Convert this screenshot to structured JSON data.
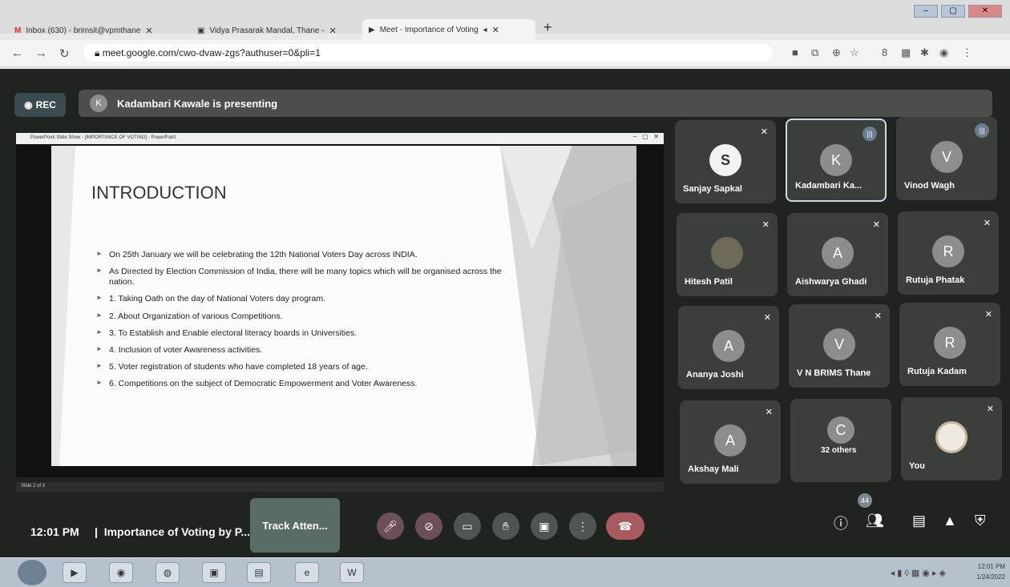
{
  "browser": {
    "tabs": [
      {
        "label": "Inbox (630) - brimsit@vpmthane",
        "icon": "gmail-icon"
      },
      {
        "label": "Vidya Prasarak Mandal, Thane -",
        "icon": "page-icon"
      },
      {
        "label": "Meet - Importance of Voting",
        "icon": "meet-icon"
      }
    ],
    "url": "meet.google.com/cwo-dvaw-zgs?authuser=0&pli=1"
  },
  "meet": {
    "rec_label": "REC",
    "presenting_initial": "K",
    "presenting_text": "Kadambari Kawale is presenting",
    "clock": "12:01 PM",
    "meeting_title": "Importance of Voting by P...",
    "track_label": "Track Atten...",
    "people_badge": "44"
  },
  "slide": {
    "window_title": "PowerPoint Slide Show - [IMPORTANCE OF VOTING] - PowerPoint",
    "heading": "INTRODUCTION",
    "bullets": [
      "On 25th January we will be celebrating the 12th National Voters Day across INDIA.",
      "As Directed by Election Commission of India, there will be many topics which will be organised across the nation.",
      "1. Taking Oath on the day of National Voters day program.",
      "2. About Organization of various Competitions.",
      "3. To Establish and Enable electoral literacy boards in Universities.",
      "4. Inclusion of voter Awareness activities.",
      "5. Voter registration of students who have completed 18 years of age.",
      "6. Competitions on the subject of Democratic Empowerment and Voter Awareness."
    ],
    "footer": "Slide 2 of 3"
  },
  "participants": [
    {
      "name": "Sanjay Sapkal",
      "initial": "S",
      "mic": "muted"
    },
    {
      "name": "Kadambari Ka...",
      "initial": "K",
      "mic": "talking"
    },
    {
      "name": "Vinod Wagh",
      "initial": "V",
      "mic": "talking"
    },
    {
      "name": "Hitesh Patil",
      "initial": "",
      "mic": "muted"
    },
    {
      "name": "Aishwarya Ghadi",
      "initial": "A",
      "mic": "muted"
    },
    {
      "name": "Rutuja Phatak",
      "initial": "R",
      "mic": "muted"
    },
    {
      "name": "Ananya Joshi",
      "initial": "A",
      "mic": "muted"
    },
    {
      "name": "V N BRIMS Thane",
      "initial": "V",
      "mic": "muted"
    },
    {
      "name": "Rutuja Kadam",
      "initial": "R",
      "mic": "muted"
    },
    {
      "name": "Akshay Mali",
      "initial": "A",
      "mic": "muted"
    },
    {
      "name": "32 others",
      "initial": "C",
      "mic": "none"
    },
    {
      "name": "You",
      "initial": "",
      "mic": "muted"
    }
  ],
  "taskbar": {
    "time": "12:01 PM",
    "date": "1/24/2022"
  }
}
